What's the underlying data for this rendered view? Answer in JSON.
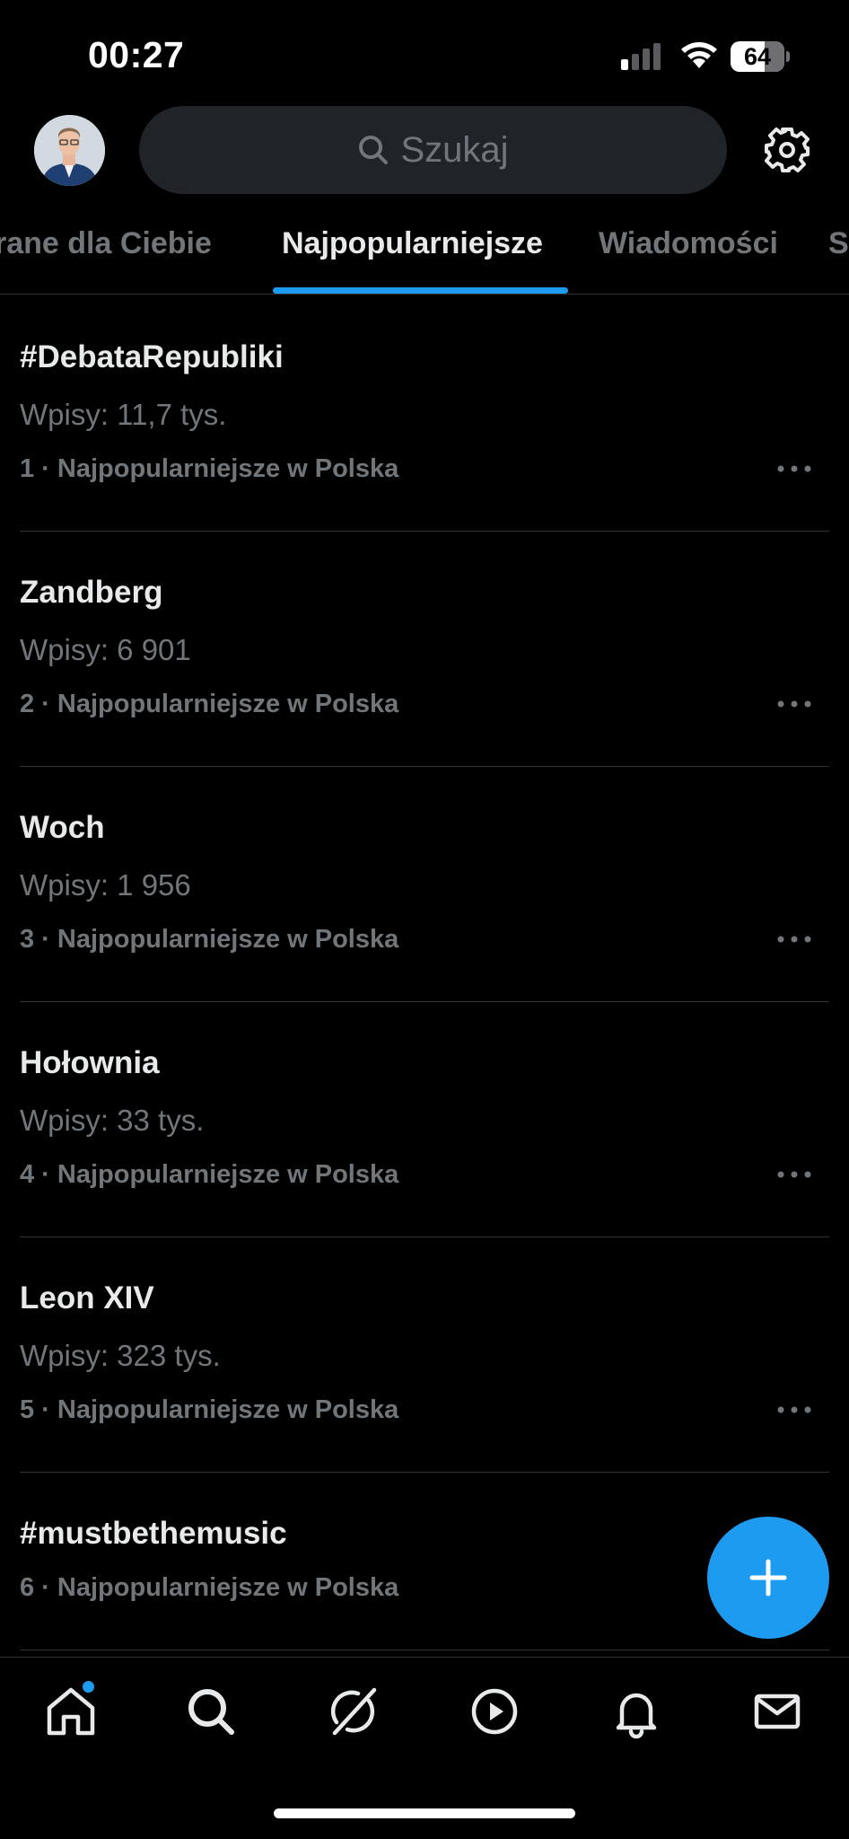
{
  "status_bar": {
    "time": "00:27",
    "battery_level": "64",
    "signal_bars_active": 1,
    "signal_bars_total": 4
  },
  "header": {
    "search_placeholder": "Szukaj",
    "avatar_icon": "profile-avatar",
    "settings_icon": "gear-icon"
  },
  "tabs": [
    {
      "label": "Wybrane dla Ciebie",
      "visible_label": "rane dla Ciebie",
      "active": false
    },
    {
      "label": "Najpopularniejsze",
      "active": true
    },
    {
      "label": "Wiadomości",
      "active": false
    },
    {
      "label": "S",
      "active": false
    }
  ],
  "trends": [
    {
      "title": "#DebataRepubliki",
      "count": "Wpisy: 11,7 tys.",
      "meta": "1 · Najpopularniejsze w Polska"
    },
    {
      "title": "Zandberg",
      "count": "Wpisy: 6 901",
      "meta": "2 · Najpopularniejsze w Polska"
    },
    {
      "title": "Woch",
      "count": "Wpisy: 1 956",
      "meta": "3 · Najpopularniejsze w Polska"
    },
    {
      "title": "Hołownia",
      "count": "Wpisy: 33 tys.",
      "meta": "4 · Najpopularniejsze w Polska"
    },
    {
      "title": "Leon XIV",
      "count": "Wpisy: 323 tys.",
      "meta": "5 · Najpopularniejsze w Polska"
    },
    {
      "title": "#mustbethemusic",
      "count": "",
      "meta": "6 · Najpopularniejsze w Polska"
    }
  ],
  "bottom_nav": [
    {
      "name": "home-icon",
      "has_notification_dot": true
    },
    {
      "name": "search-icon"
    },
    {
      "name": "grok-icon"
    },
    {
      "name": "video-icon"
    },
    {
      "name": "bell-icon"
    },
    {
      "name": "mail-icon"
    }
  ],
  "colors": {
    "background": "#000000",
    "accent": "#1d9bf0",
    "primary_text": "#e7e9ea",
    "secondary_text": "#71767b",
    "divider": "#2f3336"
  }
}
